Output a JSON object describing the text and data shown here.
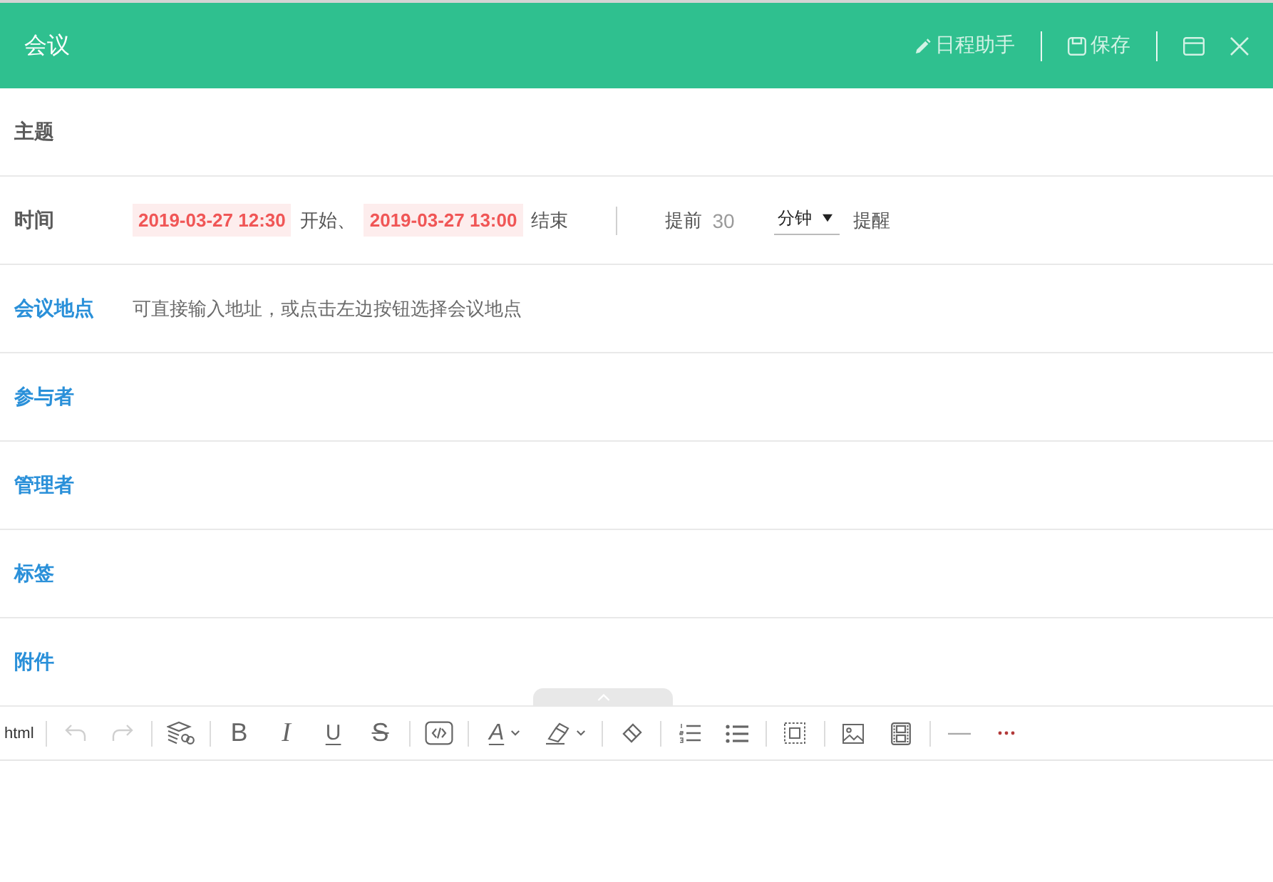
{
  "window": {
    "title": "会议",
    "actions": [
      {
        "kind": "assistant",
        "label": "日程助手"
      },
      {
        "kind": "save",
        "label": "保存"
      }
    ],
    "controls": [
      {
        "kind": "restore"
      },
      {
        "kind": "close"
      }
    ]
  },
  "form": {
    "rows": [
      {
        "kind": "plain",
        "label": "主题"
      },
      {
        "kind": "time",
        "label": "时间",
        "start": "2019-03-27 12:30",
        "start_suffix": "开始、",
        "end": "2019-03-27 13:00",
        "end_suffix": "结束",
        "remind_before": "提前",
        "remind_value": "30",
        "remind_unit": "分钟",
        "remind_after": "提醒"
      },
      {
        "kind": "picker",
        "label": "会议地点",
        "placeholder": "可直接输入地址，或点击左边按钮选择会议地点"
      },
      {
        "kind": "picker",
        "label": "参与者"
      },
      {
        "kind": "picker",
        "label": "管理者"
      },
      {
        "kind": "picker",
        "label": "标签"
      },
      {
        "kind": "picker",
        "label": "附件"
      }
    ]
  },
  "editor": {
    "toolbar": {
      "groups": [
        {
          "tools": [
            {
              "kind": "html",
              "label": "html",
              "disabled": false
            }
          ]
        },
        {
          "tools": [
            {
              "kind": "undo",
              "disabled": true
            },
            {
              "kind": "redo",
              "disabled": true
            }
          ]
        },
        {
          "tools": [
            {
              "kind": "format",
              "disabled": false
            }
          ]
        },
        {
          "tools": [
            {
              "kind": "bold",
              "label": "B",
              "disabled": false
            },
            {
              "kind": "italic",
              "label": "I",
              "disabled": false
            },
            {
              "kind": "underline",
              "label": "U",
              "disabled": false
            },
            {
              "kind": "strike",
              "label": "S",
              "disabled": false
            }
          ]
        },
        {
          "tools": [
            {
              "kind": "code",
              "disabled": false
            }
          ]
        },
        {
          "tools": [
            {
              "kind": "font_color",
              "label": "A",
              "disabled": false
            },
            {
              "kind": "highlight",
              "disabled": false
            }
          ]
        },
        {
          "tools": [
            {
              "kind": "eraser",
              "disabled": false
            }
          ]
        },
        {
          "tools": [
            {
              "kind": "ordered_list",
              "disabled": false
            },
            {
              "kind": "bullet_list",
              "disabled": false
            }
          ]
        },
        {
          "tools": [
            {
              "kind": "select_all",
              "disabled": false
            }
          ]
        },
        {
          "tools": [
            {
              "kind": "image",
              "disabled": false
            },
            {
              "kind": "video",
              "disabled": false
            }
          ]
        },
        {
          "tools": [
            {
              "kind": "rule",
              "disabled": false
            },
            {
              "kind": "more",
              "disabled": false
            }
          ]
        }
      ]
    }
  }
}
